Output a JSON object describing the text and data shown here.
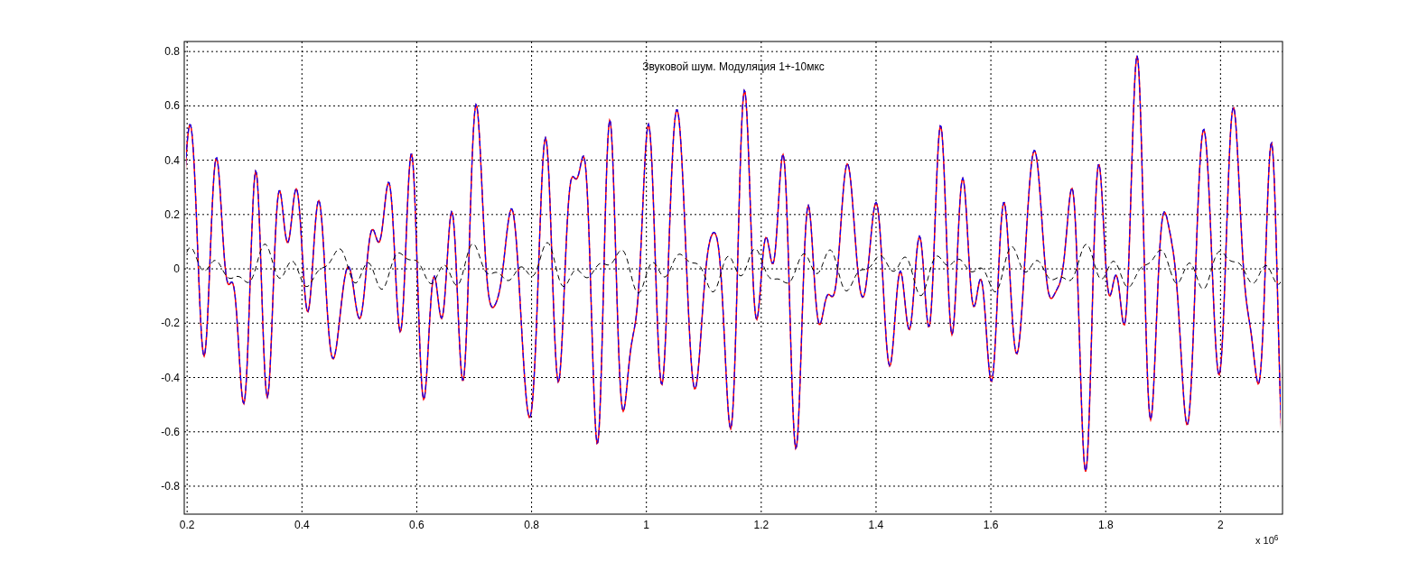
{
  "figure": {
    "chart_data": {
      "type": "line",
      "title": "Звуковой шум. Модуляция 1+-10мкс",
      "grid": true,
      "xlim": [
        0.195,
        2.108
      ],
      "ylim": [
        -0.903,
        0.837
      ],
      "xticks": [
        0.2,
        0.4,
        0.6,
        0.8,
        {
          "value": 1,
          "label": "1"
        },
        1.2,
        1.4,
        1.6,
        1.8,
        {
          "value": 2,
          "label": "2"
        }
      ],
      "yticks": [
        -0.8,
        -0.6,
        -0.4,
        -0.2,
        {
          "value": 0,
          "label": "0"
        },
        0.2,
        0.4,
        0.6,
        0.8
      ]
    },
    "x_multiplier_label": "x 10$^{6}$"
  }
}
